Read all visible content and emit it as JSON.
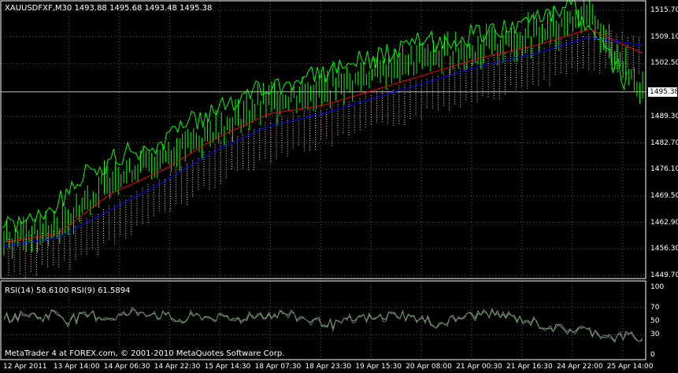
{
  "symbol_header": {
    "text": "XAUUSDFXF,M30  1493.88 1495.68 1493.48 1495.38"
  },
  "price_axis": {
    "labels": [
      "1515.70",
      "1509.10",
      "1502.50",
      "1489.30",
      "1482.70",
      "1476.10",
      "1469.50",
      "1462.90",
      "1456.30",
      "1449.70"
    ],
    "current_price": "1495.38",
    "range": [
      1449.7,
      1515.7
    ]
  },
  "rsi_panel": {
    "title": "RSI(14) 58.6100  RSI(9) 61.5894",
    "levels": [
      "100",
      "70",
      "50",
      "30",
      "0"
    ]
  },
  "time_axis": {
    "labels": [
      "12 Apr 2011",
      "13 Apr 14:00",
      "14 Apr 06:30",
      "14 Apr 22:30",
      "15 Apr 14:30",
      "18 Apr 07:30",
      "18 Apr 23:30",
      "19 Apr 15:30",
      "20 Apr 08:00",
      "21 Apr 00:30",
      "21 Apr 16:30",
      "24 Apr 22:00",
      "25 Apr 14:00"
    ]
  },
  "footer": {
    "copyright": "MetaTrader 4 at FOREX.com, © 2001-2010 MetaQuotes Software Corp."
  },
  "colors": {
    "background": "#000000",
    "bar": "#00ff00",
    "chikou": "#00ff00",
    "tenkan": "#ff0000",
    "kijun": "#0000ff",
    "cloud": "#ffd8c8",
    "grid": "#606060",
    "rsi_line": "#7fa07f",
    "axis_text": "#ffffff"
  },
  "chart_data": {
    "type": "line",
    "title": "",
    "xlabel": "",
    "ylabel": "",
    "ylim": [
      1449.7,
      1515.7
    ],
    "x": [
      "12 Apr 2011",
      "13 Apr 14:00",
      "14 Apr 06:30",
      "14 Apr 22:30",
      "15 Apr 14:30",
      "18 Apr 07:30",
      "18 Apr 23:30",
      "19 Apr 15:30",
      "20 Apr 08:00",
      "21 Apr 00:30",
      "21 Apr 16:30",
      "24 Apr 22:00",
      "25 Apr 14:00"
    ],
    "series": [
      {
        "values": [
          1459,
          1461,
          1474,
          1479,
          1486,
          1493,
          1496,
          1500,
          1504,
          1506,
          1510,
          1514,
          1495.38
        ]
      },
      {
        "values": [
          1458,
          1460,
          1470,
          1476,
          1484,
          1490,
          1492,
          1496,
          1500,
          1504,
          1507,
          1511,
          1505
        ]
      },
      {
        "values": [
          1457,
          1459,
          1466,
          1473,
          1481,
          1487,
          1490,
          1494,
          1498,
          1502,
          1505,
          1509,
          1507
        ]
      }
    ],
    "rsi": {
      "ylim": [
        0,
        100
      ],
      "values": [
        52,
        58,
        60,
        55,
        63,
        52,
        56,
        60,
        54,
        58,
        62,
        64,
        60,
        55,
        50,
        58,
        56,
        54,
        52,
        56,
        60,
        58,
        62,
        56,
        52,
        48,
        45,
        50,
        55,
        52,
        58,
        60,
        55,
        50,
        45,
        52,
        56,
        60,
        62,
        58,
        54,
        50,
        45,
        40,
        36,
        38,
        35,
        30,
        25,
        30,
        22
      ]
    }
  }
}
